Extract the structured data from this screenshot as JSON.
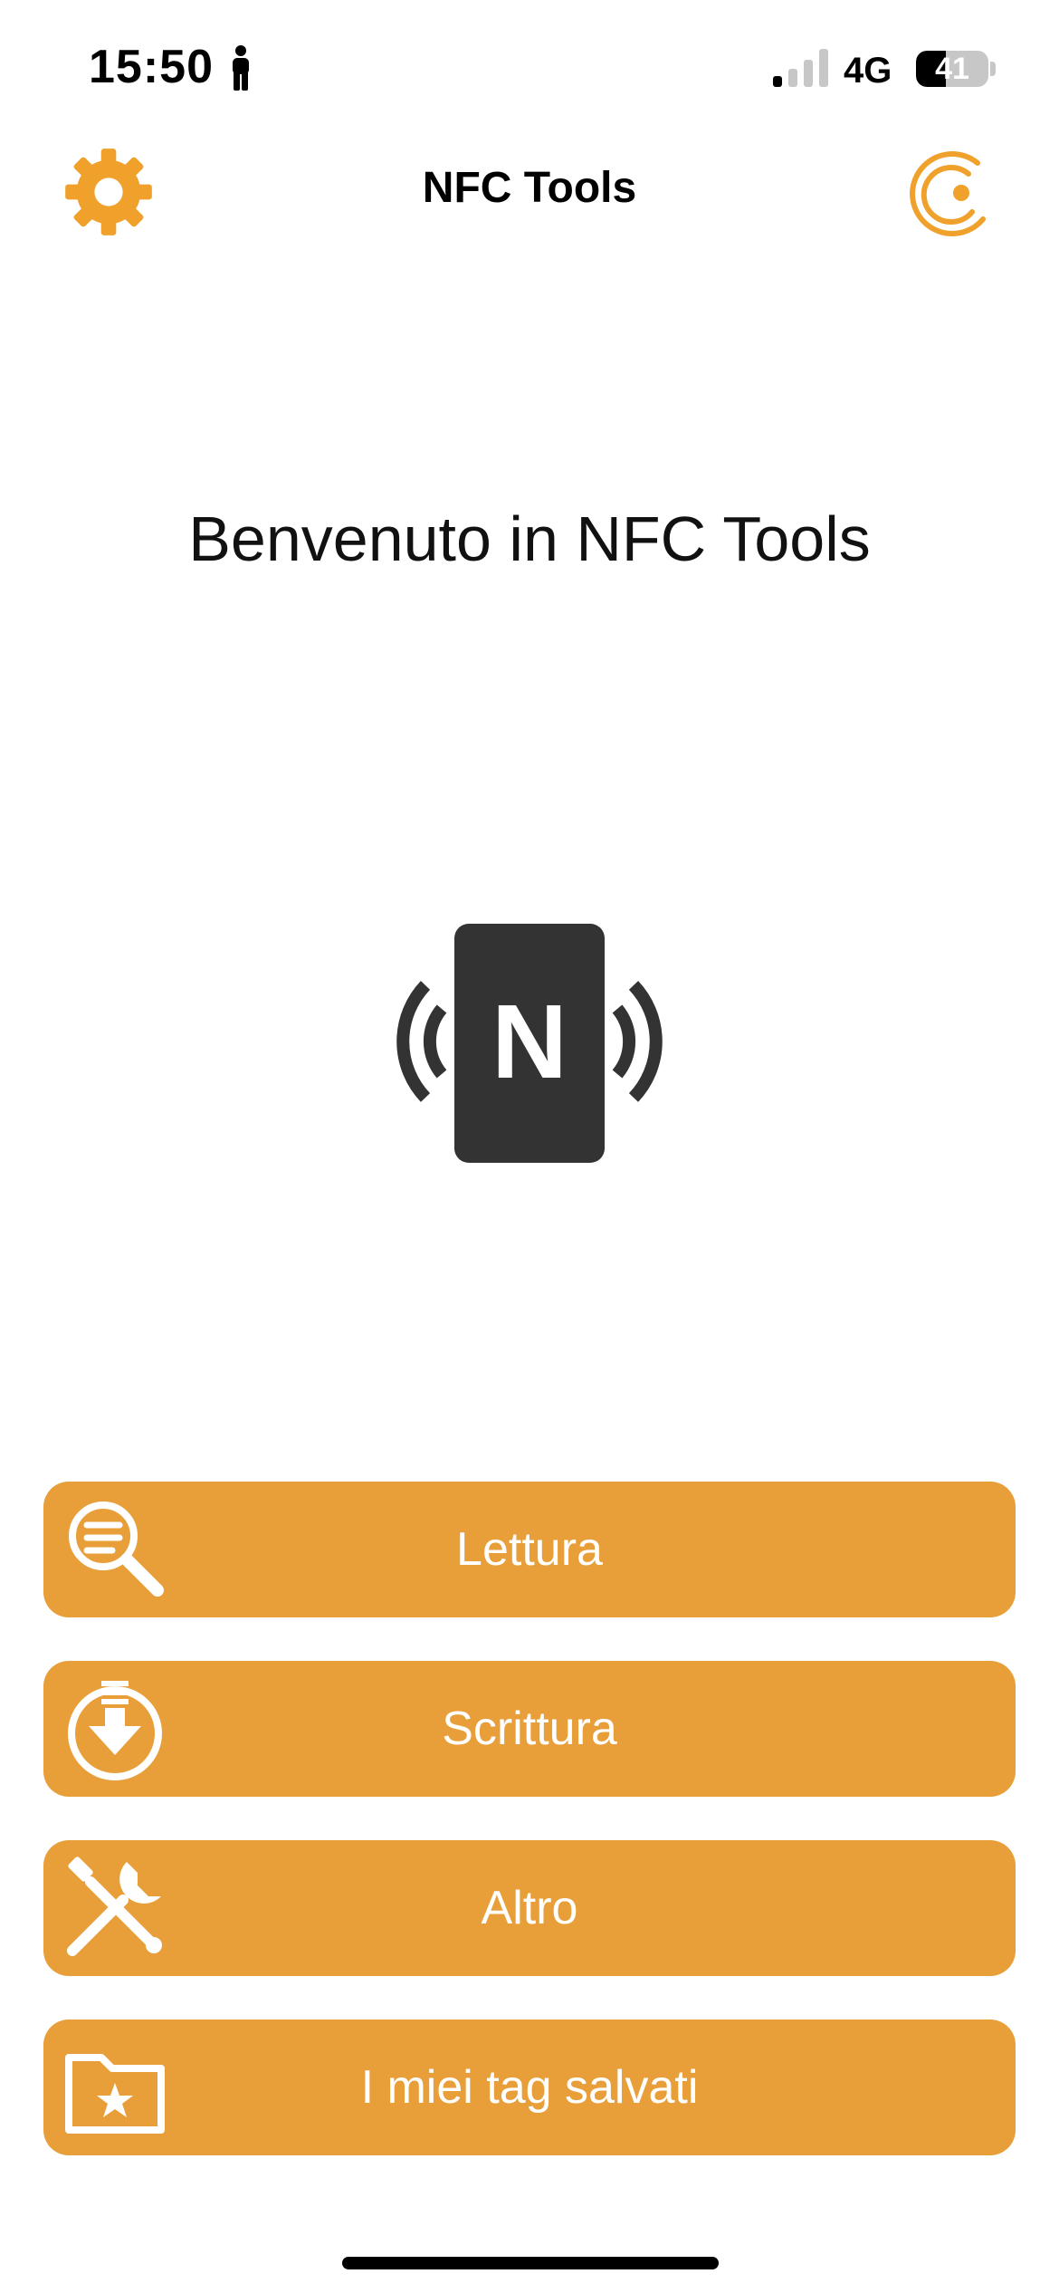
{
  "status_bar": {
    "time": "15:50",
    "network": "4G",
    "battery_percent": "41",
    "battery_level": 0.41,
    "signal_bars_active": 1,
    "signal_bars_total": 4,
    "person_icon": "person-standing-icon"
  },
  "nav": {
    "title": "NFC Tools",
    "settings_icon": "gear-icon",
    "brand_icon": "wakdev-logo-icon",
    "accent_color": "#f0a12c"
  },
  "main": {
    "welcome_text": "Benvenuto in NFC Tools",
    "logo_letter": "N",
    "logo_color": "#333333"
  },
  "menu": {
    "button_color": "#e89f3a",
    "items": [
      {
        "label": "Lettura",
        "icon": "magnifier-list-icon"
      },
      {
        "label": "Scrittura",
        "icon": "download-circle-icon"
      },
      {
        "label": "Altro",
        "icon": "wrench-screwdriver-icon"
      },
      {
        "label": "I miei tag salvati",
        "icon": "folder-star-icon"
      }
    ]
  }
}
